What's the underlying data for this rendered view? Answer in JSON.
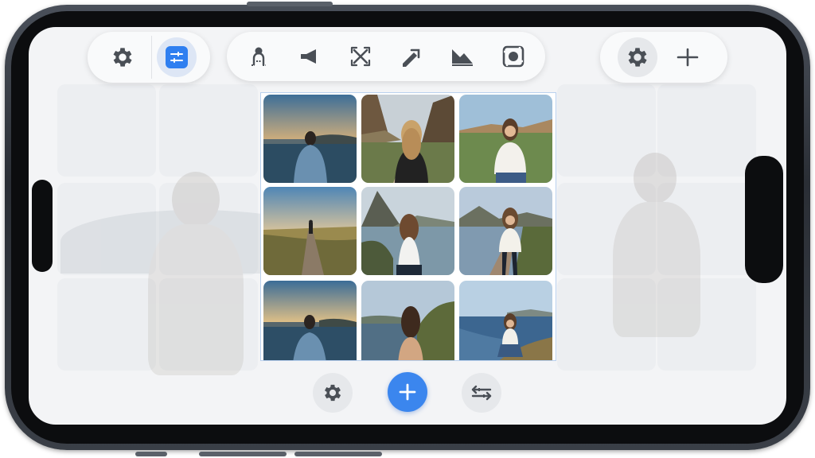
{
  "window": {
    "title": ""
  },
  "colors": {
    "accent": "#3b86ee",
    "toolbar_bg": "#f9fafb",
    "screen_bg": "#f3f4f6",
    "icon": "#4a4f56",
    "grid_border": "#b9d0ee"
  },
  "toolbar_left": {
    "items": [
      {
        "name": "settings",
        "icon": "gear-icon"
      },
      {
        "name": "adjust",
        "icon": "sliders-icon",
        "active": true
      }
    ]
  },
  "toolbar_middle": {
    "items": [
      {
        "name": "portrait",
        "icon": "person-icon"
      },
      {
        "name": "announce",
        "icon": "megaphone-icon"
      },
      {
        "name": "transform",
        "icon": "cross-arrows-icon"
      },
      {
        "name": "pen",
        "icon": "pen-icon"
      },
      {
        "name": "terrain",
        "icon": "terrain-icon"
      },
      {
        "name": "frame",
        "icon": "frame-icon"
      }
    ]
  },
  "toolbar_right": {
    "items": [
      {
        "name": "settings",
        "icon": "gear-icon"
      },
      {
        "name": "split",
        "icon": "split-icon"
      }
    ]
  },
  "grid": {
    "rows": 3,
    "columns": 3,
    "photos": [
      {
        "scene": "sunset-lake-back"
      },
      {
        "scene": "canyon-road-back"
      },
      {
        "scene": "meadow-smiling"
      },
      {
        "scene": "path-distant-figure"
      },
      {
        "scene": "lake-mountain-back"
      },
      {
        "scene": "pier-walking"
      },
      {
        "scene": "sunset-lake-back"
      },
      {
        "scene": "bay-back"
      },
      {
        "scene": "shore-sitting"
      }
    ]
  },
  "bottom_bar": {
    "items": [
      {
        "name": "settings",
        "icon": "gear-icon"
      },
      {
        "name": "add",
        "icon": "plus-icon"
      },
      {
        "name": "reorder",
        "icon": "swap-icon"
      }
    ]
  }
}
